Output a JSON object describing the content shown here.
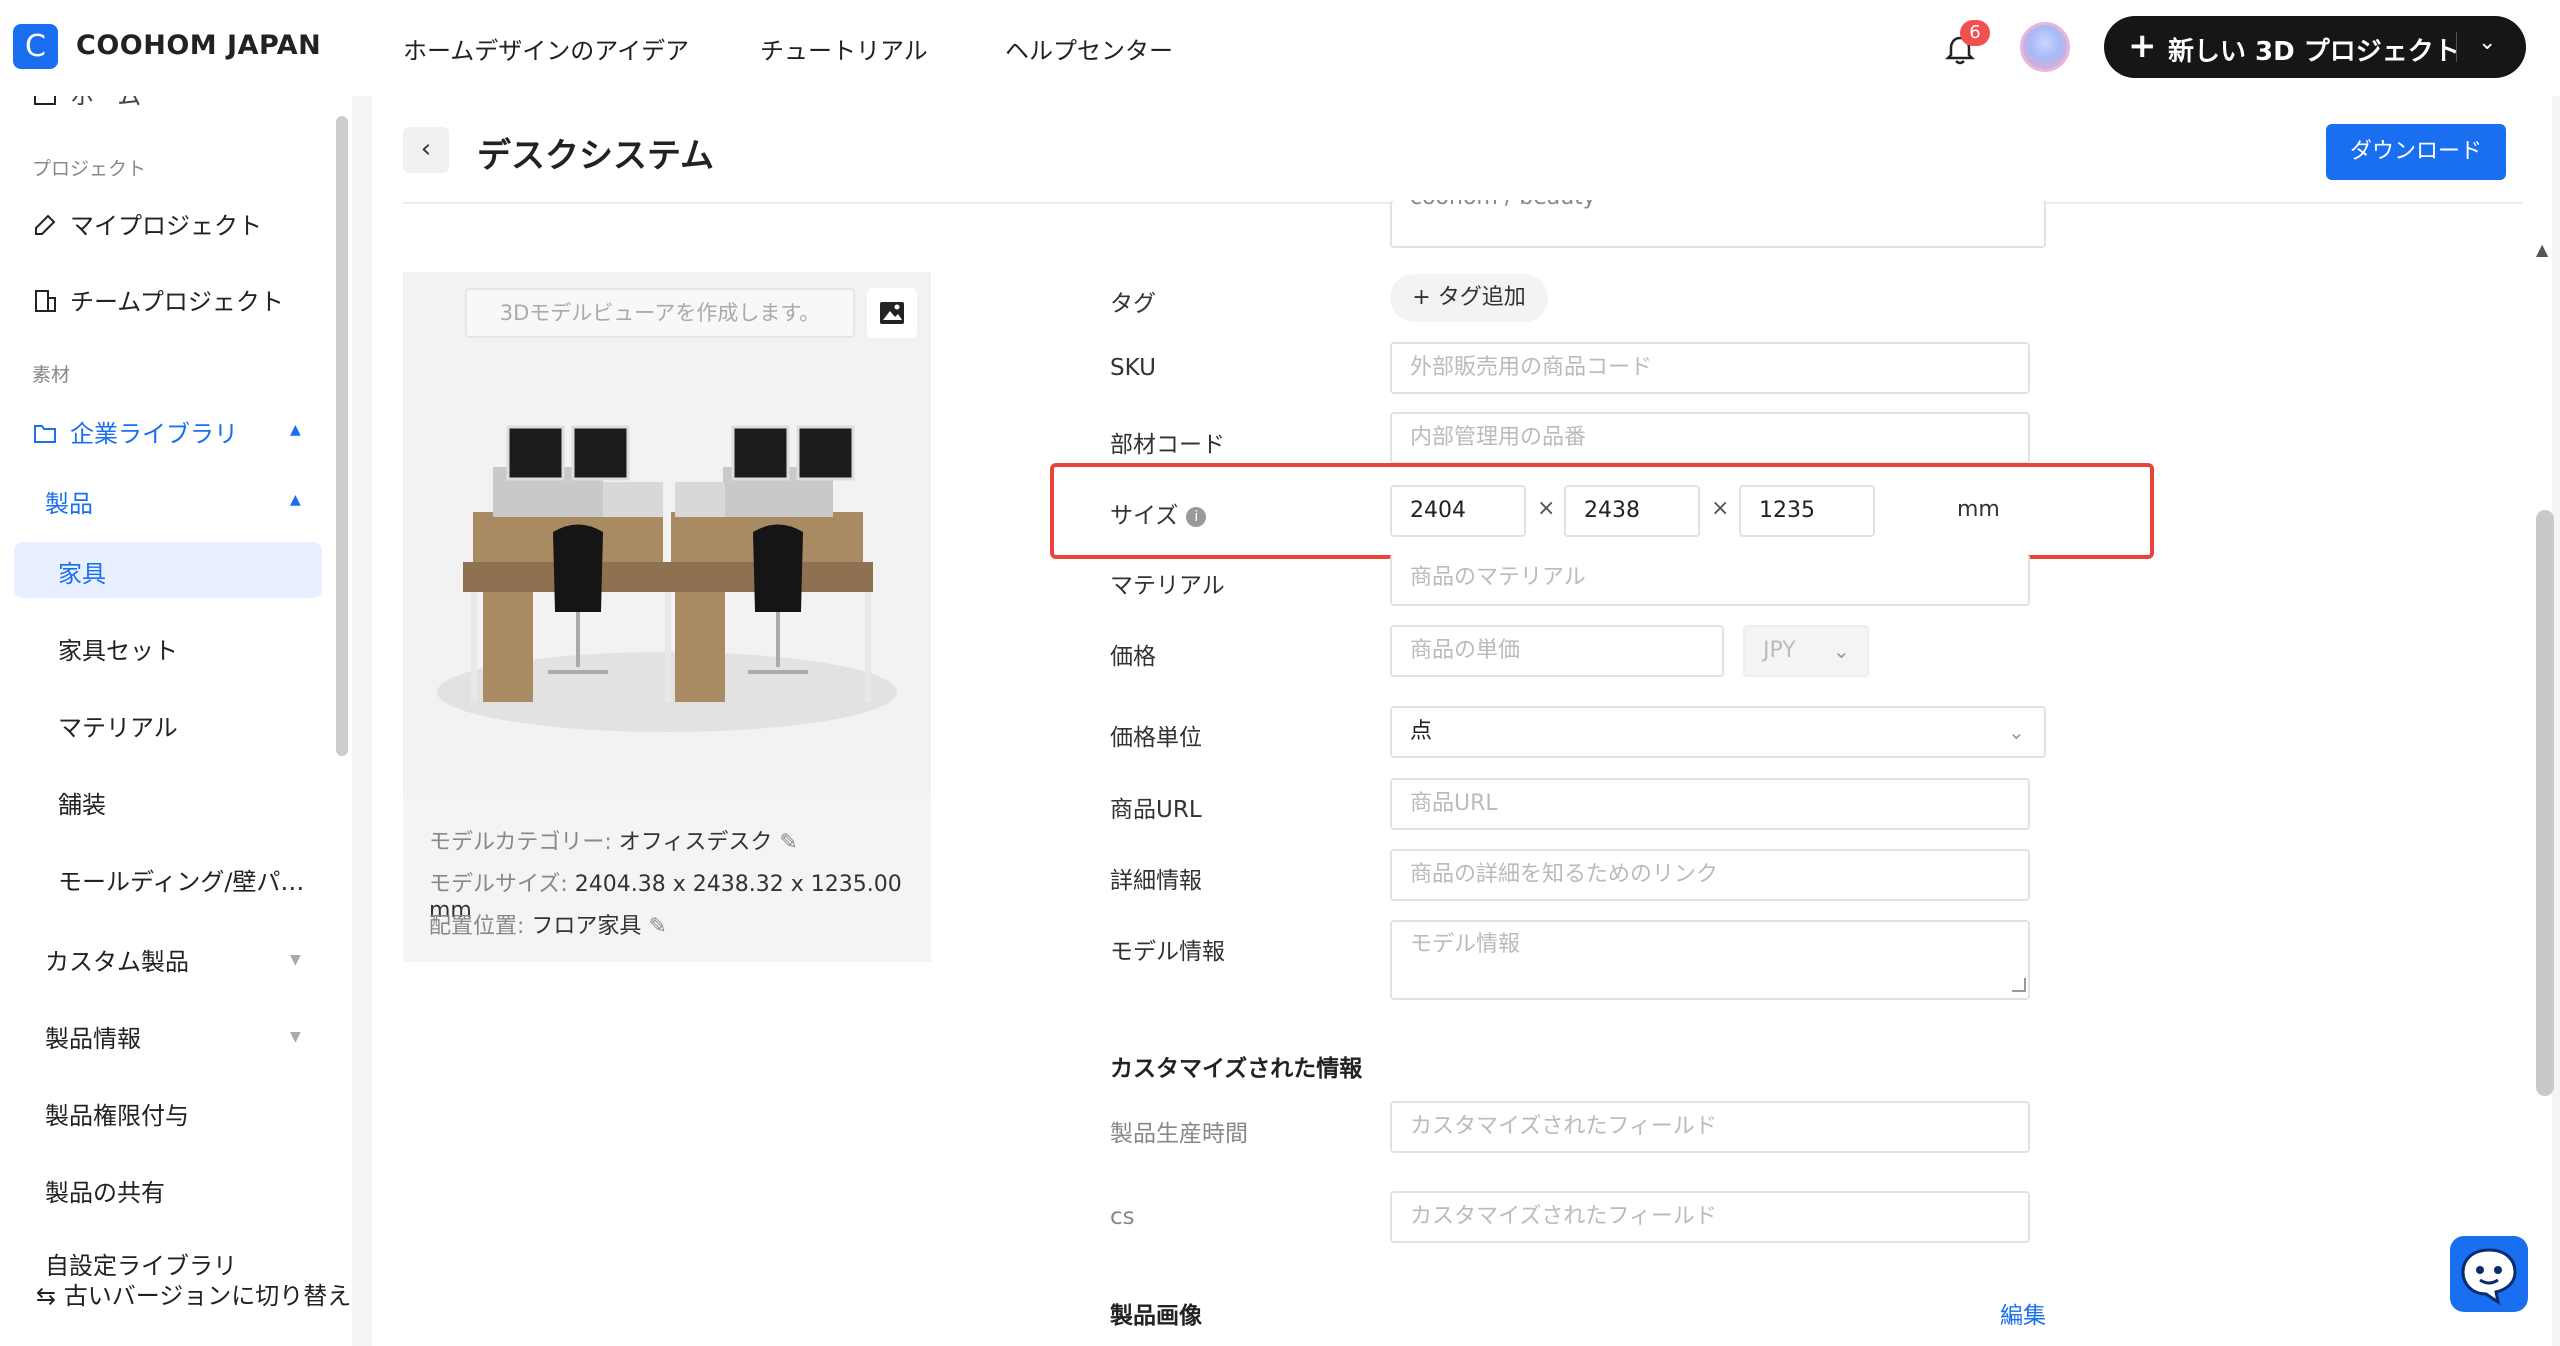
{
  "app": {
    "brand": "COOHOM JAPAN",
    "logo_letter": "C",
    "nav": [
      "ホームデザインのアイデア",
      "チュートリアル",
      "ヘルプセンター"
    ],
    "notification_count": "6",
    "new_project_label": "新しい 3D プロジェクト",
    "accent_color": "#1a6ff0"
  },
  "sidebar": {
    "top_cut_label": "ホーム",
    "section_project": "プロジェクト",
    "my_project": "マイプロジェクト",
    "team_project": "チームプロジェクト",
    "section_material": "素材",
    "enterprise_library": "企業ライブラリ",
    "products": "製品",
    "items": [
      "家具",
      "家具セット",
      "マテリアル",
      "舗装",
      "モールディング/壁パ…"
    ],
    "custom_products": "カスタム製品",
    "product_info": "製品情報",
    "product_permissions": "製品権限付与",
    "product_share": "製品の共有",
    "custom_library_cut": "自設定ライブラリ",
    "old_version": "古いバージョンに切り替え"
  },
  "header": {
    "title": "デスクシステム",
    "download": "ダウンロード"
  },
  "preview": {
    "viewer_placeholder": "3Dモデルビューアを作成します。",
    "category_label": "モデルカテゴリー:",
    "category_value": "オフィスデスク",
    "size_label": "モデルサイズ:",
    "size_value": "2404.38 x 2438.32 x 1235.00 mm",
    "placement_label": "配置位置:",
    "placement_value": "フロア家具"
  },
  "form": {
    "brand_series_value": "coohom / beauty",
    "tag_label": "タグ",
    "tag_add": "タグ追加",
    "sku_label": "SKU",
    "sku_placeholder": "外部販売用の商品コード",
    "part_code_label": "部材コード",
    "part_code_placeholder": "内部管理用の品番",
    "size_label": "サイズ",
    "size_w": "2404",
    "size_d": "2438",
    "size_h": "1235",
    "size_times": "×",
    "size_unit": "mm",
    "material_label": "マテリアル",
    "material_placeholder": "商品のマテリアル",
    "price_label": "価格",
    "price_placeholder": "商品の単価",
    "currency": "JPY",
    "price_unit_label": "価格単位",
    "price_unit_value": "点",
    "url_label": "商品URL",
    "url_placeholder": "商品URL",
    "detail_label": "詳細情報",
    "detail_placeholder": "商品の詳細を知るためのリンク",
    "model_info_label": "モデル情報",
    "model_info_placeholder": "モデル情報",
    "custom_section": "カスタマイズされた情報",
    "production_time_label": "製品生産時間",
    "custom_placeholder": "カスタマイズされたフィールド",
    "cs_label": "cs",
    "product_images_section": "製品画像",
    "edit": "編集"
  }
}
